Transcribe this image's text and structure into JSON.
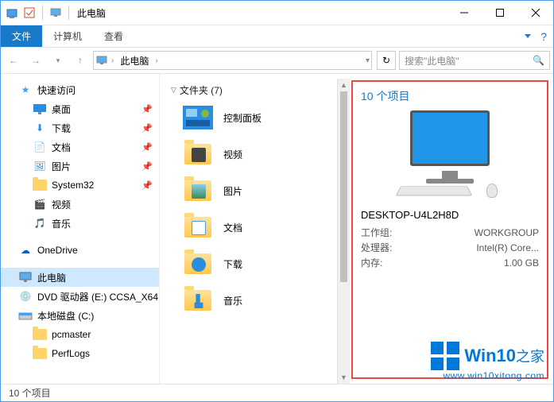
{
  "title": "此电脑",
  "ribbon": {
    "file": "文件",
    "computer": "计算机",
    "view": "查看"
  },
  "breadcrumb": "此电脑",
  "search_placeholder": "搜索\"此电脑\"",
  "sidebar": {
    "quick_access": "快速访问",
    "desktop": "桌面",
    "downloads": "下载",
    "documents": "文档",
    "pictures": "图片",
    "system32": "System32",
    "videos": "视频",
    "music": "音乐",
    "onedrive": "OneDrive",
    "this_pc": "此电脑",
    "dvd": "DVD 驱动器 (E:) CCSA_X64",
    "localdisk": "本地磁盘 (C:)",
    "pcmaster": "pcmaster",
    "perflogs": "PerfLogs"
  },
  "content": {
    "group_header": "文件夹 (7)",
    "items": {
      "control_panel": "控制面板",
      "videos": "视频",
      "pictures": "图片",
      "documents": "文档",
      "downloads": "下载",
      "music": "音乐"
    }
  },
  "details": {
    "title": "10 个项目",
    "computer_name": "DESKTOP-U4L2H8D",
    "workgroup_label": "工作组:",
    "workgroup": "WORKGROUP",
    "processor_label": "处理器:",
    "processor": "Intel(R) Core...",
    "memory_label": "内存:",
    "memory": "1.00 GB"
  },
  "status": "10 个项目",
  "watermark": {
    "brand": "Win10",
    "suffix": "之家",
    "url": "www.win10xitong.com"
  }
}
